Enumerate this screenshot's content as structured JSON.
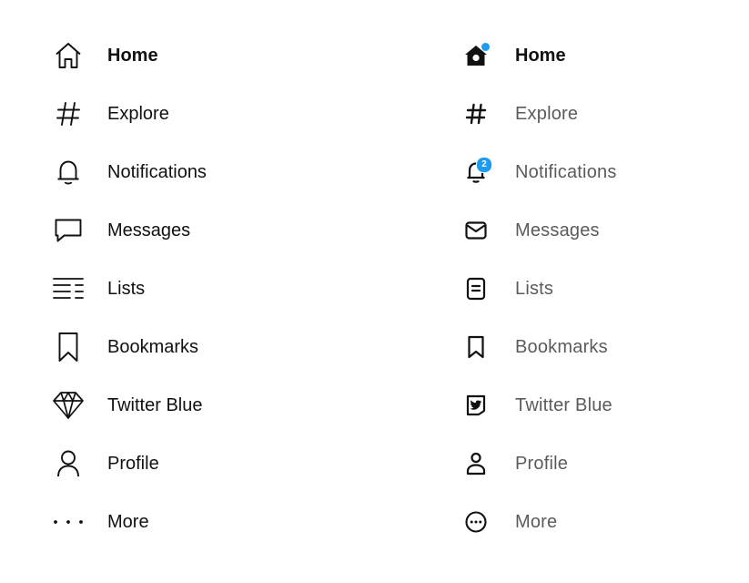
{
  "colors": {
    "accent": "#1d9bf0",
    "text_primary": "#111111",
    "text_secondary": "#5b5b5b",
    "background": "#ffffff"
  },
  "nav_left": {
    "items": [
      {
        "label": "Home",
        "icon": "home-outline-icon",
        "active": true
      },
      {
        "label": "Explore",
        "icon": "hashtag-icon"
      },
      {
        "label": "Notifications",
        "icon": "bell-outline-icon"
      },
      {
        "label": "Messages",
        "icon": "speech-bubble-icon"
      },
      {
        "label": "Lists",
        "icon": "lists-lines-icon"
      },
      {
        "label": "Bookmarks",
        "icon": "bookmark-outline-icon"
      },
      {
        "label": "Twitter Blue",
        "icon": "diamond-icon"
      },
      {
        "label": "Profile",
        "icon": "person-outline-icon"
      },
      {
        "label": "More",
        "icon": "horizontal-dots-icon"
      }
    ]
  },
  "nav_right": {
    "items": [
      {
        "label": "Home",
        "icon": "home-filled-icon",
        "active": true,
        "indicator": "dot"
      },
      {
        "label": "Explore",
        "icon": "hashtag-icon"
      },
      {
        "label": "Notifications",
        "icon": "bell-icon",
        "badge": "2"
      },
      {
        "label": "Messages",
        "icon": "envelope-icon"
      },
      {
        "label": "Lists",
        "icon": "list-document-icon"
      },
      {
        "label": "Bookmarks",
        "icon": "bookmark-icon"
      },
      {
        "label": "Twitter Blue",
        "icon": "twitter-blue-icon"
      },
      {
        "label": "Profile",
        "icon": "person-icon"
      },
      {
        "label": "More",
        "icon": "more-circle-icon"
      }
    ]
  }
}
